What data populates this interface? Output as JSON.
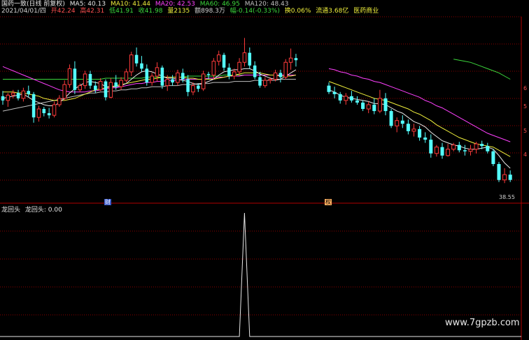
{
  "header": {
    "name": "国药一致(日线 前复权)",
    "ma5": "MA5: 40.13",
    "ma10": "MA10: 41.44",
    "ma20": "MA20: 42.53",
    "ma60": "MA60: 46.95",
    "ma120": "MA120: 48.43"
  },
  "info": {
    "date": "2021/04/01/四",
    "open": "开42.24",
    "high": "高42.31",
    "low": "低41.91",
    "close": "收41.98",
    "vol": "量2135",
    "amount": "额898.3万",
    "change": "幅-0.14(-0.33%)",
    "turnover": "换0.06%",
    "mktcap": "流通3.68亿",
    "sector": "医药商业"
  },
  "right_axis": {
    "t1": "6",
    "t2": "5",
    "t3": "5",
    "t4": "4"
  },
  "price_label": "38.55",
  "markers": {
    "left": "财",
    "right": "权"
  },
  "indicator": {
    "name": "龙回头",
    "label": "龙回头: 0.00"
  },
  "watermark": "www.7gpzb.com",
  "colors": {
    "up": "#ff3b3b",
    "down": "#54ffff",
    "ma5": "#e8e8e8",
    "ma10": "#f0f03c",
    "ma20": "#ff40ff",
    "ma60": "#3cd83c",
    "ma120": "#c0c0c0",
    "grid": "#8b0000"
  },
  "chart_data": {
    "type": "candlestick",
    "segments": [
      {
        "name": "left",
        "candles": [
          [
            44.0,
            44.5,
            43.2,
            43.6
          ],
          [
            43.6,
            44.3,
            43.0,
            44.1
          ],
          [
            44.1,
            44.6,
            43.8,
            44.3
          ],
          [
            44.3,
            44.6,
            43.6,
            43.8
          ],
          [
            43.8,
            44.8,
            43.5,
            44.5
          ],
          [
            44.5,
            45.0,
            43.9,
            44.2
          ],
          [
            44.2,
            44.4,
            41.5,
            42.0
          ],
          [
            42.0,
            43.1,
            41.6,
            42.8
          ],
          [
            42.8,
            43.0,
            42.1,
            42.4
          ],
          [
            42.4,
            42.9,
            41.9,
            42.2
          ],
          [
            42.2,
            43.5,
            42.0,
            43.2
          ],
          [
            43.2,
            44.1,
            43.0,
            43.8
          ],
          [
            43.8,
            45.5,
            43.6,
            45.1
          ],
          [
            45.1,
            47.0,
            44.8,
            46.6
          ],
          [
            46.6,
            47.3,
            44.2,
            44.6
          ],
          [
            44.6,
            45.2,
            44.4,
            45.0
          ],
          [
            45.0,
            46.4,
            44.7,
            46.1
          ],
          [
            46.1,
            46.4,
            44.7,
            45.0
          ],
          [
            45.0,
            45.4,
            44.3,
            44.6
          ],
          [
            44.6,
            45.7,
            44.5,
            45.4
          ],
          [
            45.4,
            45.6,
            43.6,
            43.9
          ],
          [
            43.9,
            45.7,
            43.8,
            45.3
          ],
          [
            45.3,
            46.0,
            44.6,
            44.9
          ],
          [
            44.9,
            45.8,
            44.6,
            45.5
          ],
          [
            45.5,
            46.6,
            45.3,
            46.3
          ],
          [
            46.3,
            48.2,
            45.9,
            47.9
          ],
          [
            47.9,
            48.6,
            46.8,
            47.1
          ],
          [
            47.1,
            47.8,
            46.3,
            46.6
          ],
          [
            46.6,
            47.0,
            45.0,
            45.3
          ],
          [
            45.3,
            46.2,
            45.0,
            45.9
          ],
          [
            45.9,
            47.2,
            45.4,
            46.7
          ],
          [
            46.7,
            46.9,
            44.7,
            45.0
          ],
          [
            45.0,
            46.0,
            44.5,
            45.6
          ],
          [
            45.6,
            46.0,
            45.0,
            45.3
          ],
          [
            45.3,
            46.5,
            45.0,
            46.2
          ],
          [
            46.2,
            46.6,
            45.3,
            45.6
          ],
          [
            45.6,
            46.0,
            44.0,
            44.4
          ],
          [
            44.4,
            45.3,
            44.1,
            45.0
          ],
          [
            45.0,
            45.2,
            44.4,
            44.7
          ],
          [
            44.7,
            46.4,
            44.5,
            46.1
          ],
          [
            46.1,
            46.3,
            45.6,
            46.0
          ],
          [
            46.0,
            47.6,
            45.6,
            47.3
          ],
          [
            47.3,
            48.3,
            46.9,
            47.9
          ],
          [
            47.9,
            48.1,
            46.4,
            46.7
          ],
          [
            46.7,
            47.1,
            45.6,
            45.9
          ],
          [
            45.9,
            46.6,
            45.6,
            46.3
          ],
          [
            46.3,
            47.6,
            45.9,
            47.2
          ],
          [
            47.2,
            49.5,
            46.8,
            48.1
          ],
          [
            48.1,
            48.6,
            46.6,
            46.9
          ],
          [
            46.9,
            47.3,
            45.6,
            45.8
          ],
          [
            45.8,
            46.3,
            44.8,
            45.0
          ],
          [
            45.0,
            45.8,
            44.8,
            45.5
          ],
          [
            45.5,
            45.8,
            45.2,
            45.6
          ],
          [
            45.6,
            46.5,
            45.4,
            46.2
          ],
          [
            46.2,
            46.5,
            45.3,
            45.8
          ],
          [
            45.8,
            47.5,
            45.6,
            47.2
          ],
          [
            47.2,
            48.5,
            46.5,
            47.6
          ],
          [
            47.6,
            48.0,
            46.8,
            47.4
          ]
        ],
        "ma5": [
          43.8,
          43.9,
          44.0,
          44.1,
          44.2,
          43.9,
          43.6,
          43.4,
          43.2,
          43.1,
          43.1,
          43.4,
          43.8,
          44.3,
          44.7,
          45.0,
          45.3,
          45.4,
          45.3,
          45.2,
          44.9,
          44.9,
          44.9,
          45.0,
          45.2,
          45.6,
          46.0,
          46.3,
          46.4,
          46.3,
          46.1,
          45.9,
          45.7,
          45.7,
          45.6,
          45.5,
          45.4,
          45.2,
          45.1,
          45.2,
          45.4,
          45.6,
          46.0,
          46.3,
          46.4,
          46.5,
          46.5,
          46.6,
          46.6,
          46.4,
          46.1,
          45.9,
          45.7,
          45.6,
          45.6,
          45.9,
          46.2,
          46.5
        ],
        "ma10": [
          44.4,
          44.4,
          44.4,
          44.3,
          44.3,
          44.2,
          44.1,
          44.0,
          43.8,
          43.7,
          43.6,
          43.6,
          43.6,
          43.7,
          43.8,
          44.0,
          44.2,
          44.4,
          44.6,
          44.7,
          44.8,
          44.9,
          45.0,
          45.1,
          45.2,
          45.3,
          45.4,
          45.5,
          45.6,
          45.6,
          45.7,
          45.8,
          45.8,
          45.8,
          45.8,
          45.8,
          45.7,
          45.7,
          45.6,
          45.6,
          45.6,
          45.6,
          45.7,
          45.8,
          45.9,
          46.0,
          46.1,
          46.2,
          46.2,
          46.2,
          46.2,
          46.1,
          46.0,
          46.0,
          45.9,
          45.9,
          45.9,
          46.0
        ],
        "ma20": [
          46.8,
          46.6,
          46.4,
          46.2,
          46.0,
          45.8,
          45.6,
          45.4,
          45.2,
          45.0,
          44.8,
          44.6,
          44.5,
          44.4,
          44.4,
          44.4,
          44.4,
          44.5,
          44.5,
          44.6,
          44.7,
          44.8,
          44.8,
          44.9,
          45.0,
          45.1,
          45.2,
          45.2,
          45.3,
          45.3,
          45.4,
          45.4,
          45.5,
          45.5,
          45.5,
          45.6,
          45.6,
          45.6,
          45.6,
          45.6,
          45.7,
          45.7,
          45.8,
          45.8,
          45.9,
          45.9,
          45.9,
          46.0,
          46.0,
          46.0,
          46.0,
          46.0,
          46.0,
          46.0,
          46.0,
          46.0,
          46.0,
          46.0
        ],
        "ma60": [
          45.6,
          45.6,
          45.6,
          45.6,
          45.6,
          45.6,
          45.6,
          45.6,
          45.6,
          45.6,
          45.6,
          45.6,
          45.6,
          45.6,
          45.6,
          45.6,
          45.6,
          45.6,
          45.6,
          45.6,
          45.7,
          45.7,
          45.7,
          45.7,
          45.7,
          45.7,
          45.7,
          45.7,
          45.8,
          45.8,
          45.8,
          45.8,
          45.8,
          45.8,
          45.8,
          45.8,
          45.9,
          45.9,
          45.9,
          45.9,
          45.9,
          45.9,
          45.9,
          46.0,
          46.0,
          46.0,
          46.0,
          46.0,
          46.0,
          46.0,
          46.0,
          46.0,
          46.0,
          46.0,
          46.0,
          46.0,
          46.0,
          46.0
        ],
        "ma120": [
          42.6,
          42.7,
          42.8,
          42.9,
          43.0,
          43.1,
          43.2,
          43.3,
          43.4,
          43.5,
          43.6,
          43.7,
          43.8,
          43.9,
          44.0,
          44.1,
          44.2,
          44.3,
          44.3,
          44.4,
          44.4,
          44.5,
          44.5,
          44.6,
          44.6,
          44.7,
          44.7,
          44.8,
          44.8,
          44.9,
          44.9,
          44.9,
          45.0,
          45.0,
          45.0,
          45.1,
          45.1,
          45.1,
          45.2,
          45.2,
          45.2,
          45.3,
          45.3,
          45.3,
          45.3,
          45.4,
          45.4,
          45.4,
          45.4,
          45.5,
          45.5,
          45.5,
          45.5,
          45.5,
          45.6,
          45.6,
          45.6,
          45.6
        ]
      },
      {
        "name": "right",
        "candles": [
          [
            45.0,
            45.3,
            44.2,
            44.4
          ],
          [
            44.4,
            44.9,
            43.8,
            44.2
          ],
          [
            44.2,
            44.4,
            43.3,
            43.6
          ],
          [
            43.6,
            44.3,
            43.2,
            44.0
          ],
          [
            44.0,
            44.5,
            43.4,
            43.6
          ],
          [
            43.6,
            44.0,
            43.2,
            43.4
          ],
          [
            43.4,
            43.6,
            42.6,
            42.8
          ],
          [
            42.8,
            43.5,
            42.4,
            43.2
          ],
          [
            43.2,
            43.8,
            42.3,
            42.6
          ],
          [
            42.6,
            44.6,
            42.4,
            43.8
          ],
          [
            43.8,
            44.3,
            42.2,
            42.6
          ],
          [
            42.6,
            42.8,
            41.0,
            41.2
          ],
          [
            41.2,
            42.0,
            40.6,
            41.7
          ],
          [
            41.7,
            42.2,
            41.0,
            41.4
          ],
          [
            41.4,
            41.8,
            40.4,
            40.7
          ],
          [
            40.7,
            41.4,
            40.2,
            40.9
          ],
          [
            40.9,
            41.2,
            39.8,
            40.1
          ],
          [
            40.1,
            40.6,
            39.6,
            39.9
          ],
          [
            39.9,
            40.4,
            38.2,
            38.6
          ],
          [
            38.6,
            39.4,
            38.3,
            39.2
          ],
          [
            39.2,
            39.6,
            38.1,
            38.4
          ],
          [
            38.4,
            39.5,
            38.3,
            39.0
          ],
          [
            39.0,
            39.6,
            38.8,
            39.4
          ],
          [
            39.4,
            39.7,
            38.7,
            38.9
          ],
          [
            38.9,
            39.4,
            38.4,
            38.8
          ],
          [
            38.8,
            39.4,
            38.4,
            39.0
          ],
          [
            39.0,
            39.7,
            38.6,
            39.5
          ],
          [
            39.5,
            39.8,
            39.0,
            39.3
          ],
          [
            39.3,
            39.6,
            38.6,
            38.8
          ],
          [
            38.8,
            39.0,
            37.4,
            37.6
          ],
          [
            37.6,
            37.8,
            35.9,
            36.1
          ],
          [
            36.1,
            37.2,
            35.8,
            36.6
          ],
          [
            36.6,
            37.0,
            35.9,
            36.1
          ]
        ],
        "ma5": [
          44.6,
          44.4,
          44.1,
          43.9,
          43.8,
          43.7,
          43.6,
          43.5,
          43.3,
          43.3,
          43.2,
          42.9,
          42.6,
          42.4,
          42.0,
          41.6,
          41.4,
          41.1,
          40.6,
          40.2,
          39.8,
          39.6,
          39.4,
          39.3,
          39.1,
          39.0,
          39.0,
          39.1,
          39.2,
          39.0,
          38.4,
          37.7,
          37.2
        ],
        "ma10": [
          45.4,
          45.2,
          45.0,
          44.8,
          44.6,
          44.4,
          44.2,
          44.0,
          43.8,
          43.7,
          43.6,
          43.4,
          43.2,
          43.0,
          42.8,
          42.5,
          42.3,
          42.0,
          41.7,
          41.3,
          41.0,
          40.7,
          40.4,
          40.1,
          39.9,
          39.7,
          39.5,
          39.4,
          39.3,
          39.2,
          38.9,
          38.6,
          38.3
        ],
        "ma20": [
          46.6,
          46.5,
          46.3,
          46.2,
          46.0,
          45.9,
          45.7,
          45.6,
          45.4,
          45.3,
          45.1,
          44.9,
          44.7,
          44.5,
          44.3,
          44.1,
          43.9,
          43.6,
          43.4,
          43.1,
          42.9,
          42.6,
          42.3,
          42.0,
          41.7,
          41.4,
          41.1,
          40.8,
          40.5,
          40.3,
          40.1,
          39.9,
          39.7
        ],
        "ma60": [
          null,
          null,
          null,
          null,
          null,
          null,
          null,
          null,
          null,
          null,
          null,
          null,
          null,
          null,
          null,
          null,
          null,
          null,
          null,
          null,
          null,
          null,
          47.5,
          47.4,
          47.3,
          47.2,
          47.0,
          46.8,
          46.6,
          46.4,
          46.2,
          45.9,
          45.6
        ]
      }
    ],
    "indicator": {
      "name": "龙回头",
      "ylim": [
        0,
        1
      ],
      "values": [
        0,
        0,
        0,
        0,
        0,
        0,
        0,
        0,
        0,
        0,
        0,
        0,
        0,
        0,
        0,
        0,
        0,
        0,
        0,
        0,
        0,
        0,
        0,
        0,
        0,
        0,
        0,
        0,
        0,
        0,
        0,
        0,
        0,
        0,
        0,
        0,
        0,
        0,
        0,
        0,
        0,
        0,
        0,
        0,
        0,
        0,
        0,
        1,
        0,
        0,
        0,
        0,
        0,
        0,
        0,
        0,
        0,
        0
      ]
    }
  }
}
